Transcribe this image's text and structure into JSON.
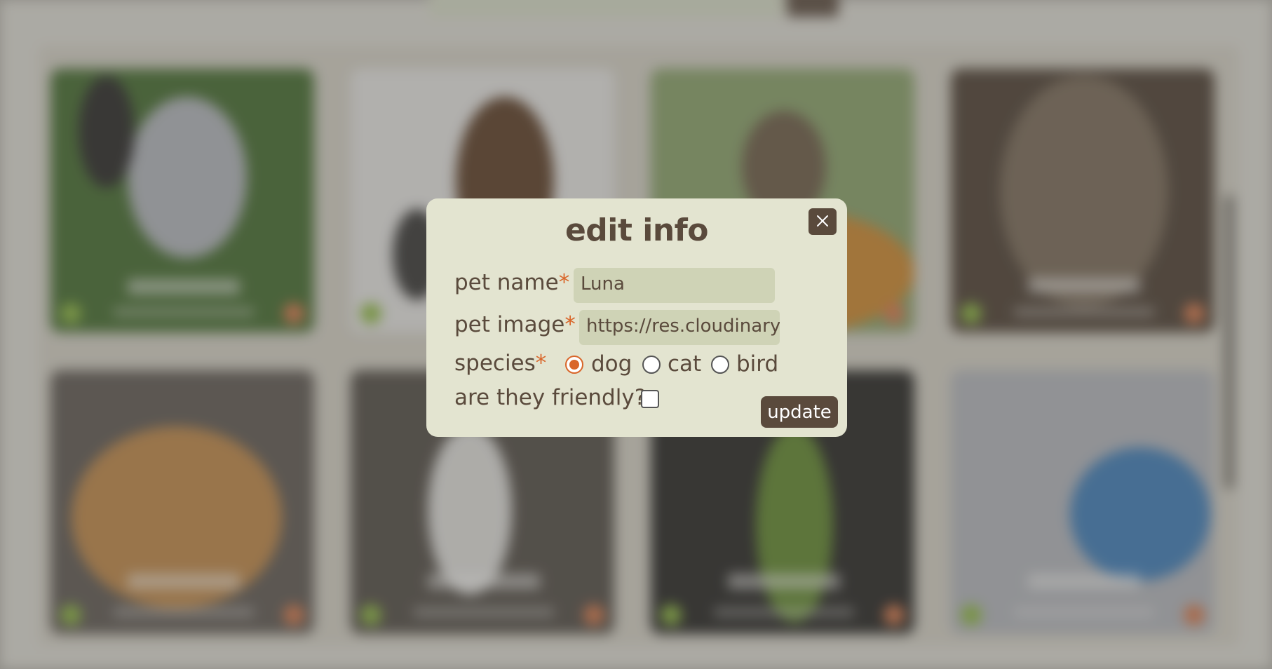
{
  "modal": {
    "title": "edit info",
    "close_icon": "close-icon",
    "pet_name_label": "pet name",
    "pet_name_value": "Luna",
    "pet_image_label": "pet image",
    "pet_image_value": "https://res.cloudinary.co",
    "species_label": "species",
    "required_mark": "*",
    "species_options": [
      "dog",
      "cat",
      "bird"
    ],
    "species_selected": "dog",
    "friendly_label": "are they friendly?",
    "friendly_checked": false,
    "update_label": "update"
  },
  "colors": {
    "modal_bg": "#e3e4d0",
    "text": "#5a4a3c",
    "accent": "#d9662a",
    "input_bg": "#cfd3b6",
    "button_bg": "#5a4a3c"
  }
}
